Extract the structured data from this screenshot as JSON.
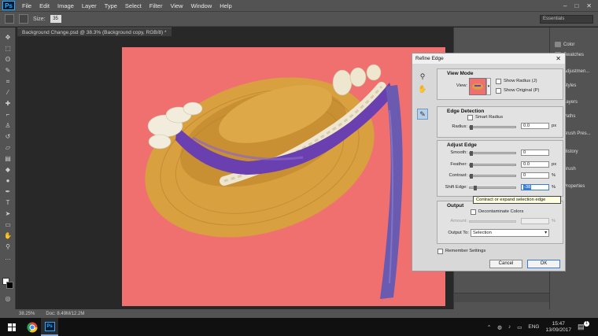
{
  "menubar": {
    "logo": "Ps",
    "items": [
      "File",
      "Edit",
      "Image",
      "Layer",
      "Type",
      "Select",
      "Filter",
      "View",
      "Window",
      "Help"
    ]
  },
  "optionsbar": {
    "size_label": "Size:",
    "size_value": "35",
    "workspace": "Essentials"
  },
  "document": {
    "tab_title": "Background Change.psd @ 38.3% (Background copy, RGB/8) *",
    "canvas_color": "#f07070"
  },
  "statusbar": {
    "zoom": "38.25%",
    "doc_size": "Doc: 8.49M/12.2M"
  },
  "right_panel": {
    "items": [
      "Color",
      "Swatches",
      "Adjustmen...",
      "Styles",
      "Layers",
      "Paths",
      "Brush Pres...",
      "History",
      "Brush",
      "Properties"
    ]
  },
  "refine_edge": {
    "title": "Refine Edge",
    "view_mode": {
      "title": "View Mode",
      "view_label": "View:",
      "show_radius": "Show Radius (J)",
      "show_original": "Show Original (P)"
    },
    "edge_detection": {
      "title": "Edge Detection",
      "smart_radius": "Smart Radius",
      "radius_label": "Radius:",
      "radius_value": "0.0",
      "radius_unit": "px"
    },
    "adjust_edge": {
      "title": "Adjust Edge",
      "smooth_label": "Smooth:",
      "smooth_value": "0",
      "feather_label": "Feather:",
      "feather_value": "0.0",
      "feather_unit": "px",
      "contrast_label": "Contrast:",
      "contrast_value": "0",
      "contrast_unit": "%",
      "shift_label": "Shift Edge:",
      "shift_value": "-38",
      "shift_unit": "%"
    },
    "tooltip": "Contract or expand selection edge",
    "output": {
      "title": "Output",
      "decontaminate": "Decontaminate Colors",
      "amount_label": "Amount:",
      "amount_unit": "%",
      "output_to_label": "Output To:",
      "output_to_value": "Selection"
    },
    "remember": "Remember Settings",
    "cancel": "Cancel",
    "ok": "OK"
  },
  "taskbar": {
    "lang": "ENG",
    "time": "15:47",
    "date": "13/09/2017",
    "notifications": "1"
  }
}
